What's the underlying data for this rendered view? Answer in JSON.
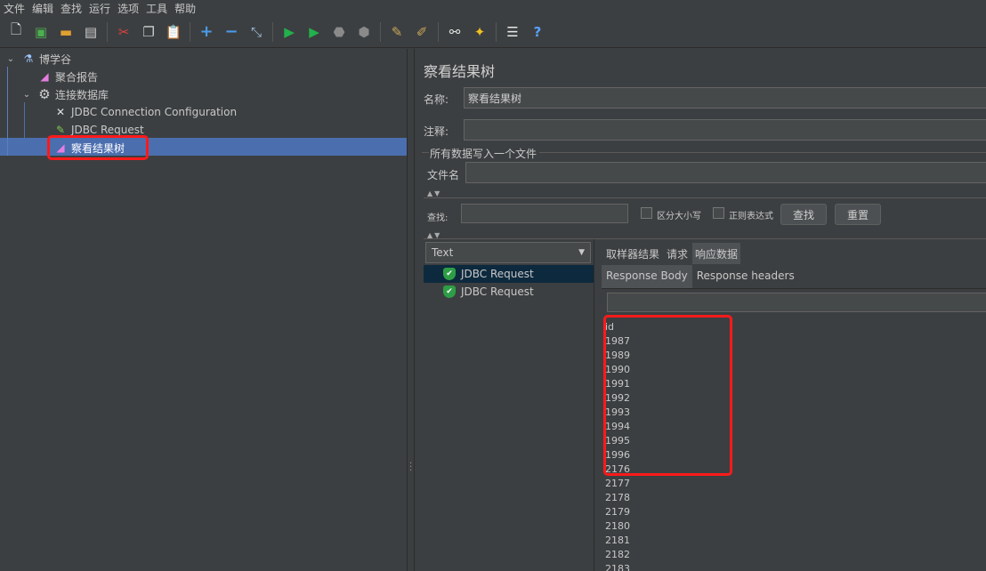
{
  "menu": [
    "文件",
    "编辑",
    "查找",
    "运行",
    "选项",
    "工具",
    "帮助"
  ],
  "toolbar": {
    "icons": [
      "new-file-icon",
      "templates-icon",
      "open-icon",
      "save-icon",
      "cut-icon",
      "copy-icon",
      "paste-icon",
      "expand-icon",
      "collapse-icon",
      "toggle-icon",
      "start-icon",
      "start-no-pause-icon",
      "stop-icon",
      "shutdown-icon",
      "clear-icon",
      "clear-all-icon",
      "search-icon",
      "reset-search-icon",
      "function-helper-icon",
      "help-icon"
    ]
  },
  "tree": {
    "root": "博学谷",
    "aggregate_report": "聚合报告",
    "thread_group": "连接数据库",
    "jdbc_config": "JDBC Connection Configuration",
    "jdbc_request": "JDBC Request",
    "results_tree": "察看结果树"
  },
  "panel": {
    "title": "察看结果树",
    "name_label": "名称:",
    "name_value": "察看结果树",
    "comment_label": "注释:",
    "comment_value": "",
    "group_title": "所有数据写入一个文件",
    "filename_label": "文件名",
    "filename_value": "",
    "search_label": "查找:",
    "search_value": "",
    "case_label": "区分大小写",
    "regex_label": "正则表达式",
    "find_button": "查找",
    "reset_button": "重置",
    "renderer": "Text",
    "results": [
      "JDBC Request",
      "JDBC Request"
    ],
    "tabs": [
      "取样器结果",
      "请求",
      "响应数据"
    ],
    "subtabs": [
      "Response Body",
      "Response headers"
    ],
    "response_lines": [
      "id",
      "1987",
      "1989",
      "1990",
      "1991",
      "1992",
      "1993",
      "1994",
      "1995",
      "1996",
      "2176",
      "2177",
      "2178",
      "2179",
      "2180",
      "2181",
      "2182",
      "2183"
    ]
  },
  "colors": {
    "selection": "#4b6eaf",
    "highlight_box": "#ff1a1a",
    "pass_icon": "#2e9e46"
  }
}
